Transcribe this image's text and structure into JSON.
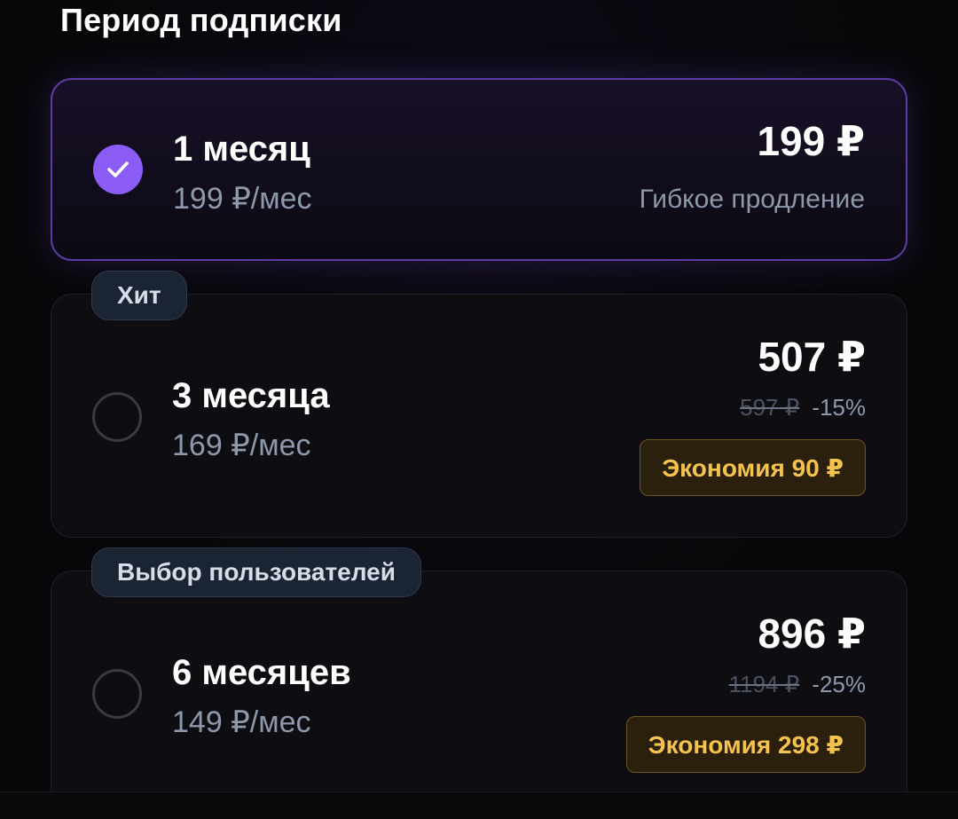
{
  "section_title": "Период подписки",
  "colors": {
    "accent": "#8b5cf6",
    "selected_border": "#5b3aa6",
    "savings_text": "#f4c24d",
    "muted_text": "#8e98ab"
  },
  "plans": [
    {
      "name": "1 месяц",
      "per_month": "199 ₽/мес",
      "price": "199 ₽",
      "note": "Гибкое продление",
      "selected": true,
      "radio_icon": "check-icon"
    },
    {
      "tag": "Хит",
      "name": "3 месяца",
      "per_month": "169 ₽/мес",
      "price": "507 ₽",
      "old_price": "597 ₽",
      "discount": "-15%",
      "savings": "Экономия 90 ₽",
      "selected": false
    },
    {
      "tag": "Выбор пользователей",
      "name": "6 месяцев",
      "per_month": "149 ₽/мес",
      "price": "896 ₽",
      "old_price": "1194 ₽",
      "discount": "-25%",
      "savings": "Экономия 298 ₽",
      "selected": false
    }
  ]
}
